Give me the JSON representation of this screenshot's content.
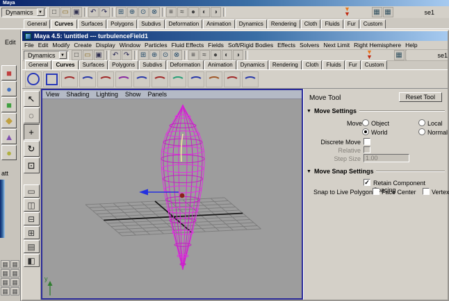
{
  "app": {
    "top_title": "Maya"
  },
  "mode_dropdown": "Dynamics",
  "status_right_text": "se1",
  "toolbar_icons": [
    {
      "n": "new-scene-icon",
      "g": "□",
      "c": "#333333"
    },
    {
      "n": "open-scene-icon",
      "g": "▭",
      "c": "#8a6a20"
    },
    {
      "n": "save-scene-icon",
      "g": "▣",
      "c": "#303050"
    },
    {
      "cls": "sep",
      "n": "separator"
    },
    {
      "n": "undo-icon",
      "g": "↶",
      "c": "#202050"
    },
    {
      "n": "redo-icon",
      "g": "↷",
      "c": "#202050"
    },
    {
      "cls": "sep",
      "n": "separator"
    },
    {
      "n": "snap-grid-icon",
      "g": "⊞",
      "c": "#204868"
    },
    {
      "n": "snap-curve-icon",
      "g": "⊕",
      "c": "#204868"
    },
    {
      "n": "snap-point-icon",
      "g": "⊙",
      "c": "#204868"
    },
    {
      "n": "snap-view-icon",
      "g": "⊗",
      "c": "#204868"
    },
    {
      "cls": "sep",
      "n": "separator"
    },
    {
      "n": "construction-history-icon",
      "g": "≡",
      "c": "#333333"
    },
    {
      "n": "list-inputs-icon",
      "g": "≈",
      "c": "#333333"
    },
    {
      "n": "render-icon",
      "g": "●",
      "c": "#444444"
    },
    {
      "n": "ipr-render-icon",
      "g": "◐",
      "c": "#444444"
    },
    {
      "n": "render-globals-icon",
      "g": "◑",
      "c": "#444444"
    },
    {
      "cls": "sep",
      "n": "separator"
    },
    {
      "n": "double-chevron-icon",
      "cls": "ic-varrow gap-left"
    },
    {
      "n": "numeric-field-grid-icon",
      "g": "▦",
      "c": "#305060",
      "cls": "gap-left-sm"
    },
    {
      "n": "numeric-field-grid-icon",
      "g": "▦",
      "c": "#305060"
    }
  ],
  "shelf_tabs": [
    {
      "label": "General"
    },
    {
      "label": "Curves",
      "selected": true
    },
    {
      "label": "Surfaces"
    },
    {
      "label": "Polygons"
    },
    {
      "label": "Subdivs"
    },
    {
      "label": "Deformation"
    },
    {
      "label": "Animation"
    },
    {
      "label": "Dynamics"
    },
    {
      "label": "Rendering"
    },
    {
      "label": "Cloth"
    },
    {
      "label": "Fluids"
    },
    {
      "label": "Fur"
    },
    {
      "label": "Custom"
    }
  ],
  "shelf_icons": [
    {
      "n": "nurbs-circle-icon",
      "cls": "ic-circle"
    },
    {
      "n": "nurbs-square-icon",
      "cls": "ic-square"
    },
    {
      "n": "pencil-curve-icon",
      "cls": "ic-arc",
      "c": "#a02828"
    },
    {
      "n": "cv-curve-icon",
      "cls": "ic-arc",
      "c": "#2838a8"
    },
    {
      "n": "ep-curve-icon",
      "cls": "ic-arc",
      "c": "#a02828"
    },
    {
      "n": "edit-curve-icon",
      "cls": "ic-arc",
      "c": "#8828a0"
    },
    {
      "n": "attach-curves-icon",
      "cls": "ic-arc",
      "c": "#2838a8"
    },
    {
      "n": "detach-curves-icon",
      "cls": "ic-arc",
      "c": "#a02828"
    },
    {
      "n": "align-curves-icon",
      "cls": "ic-arc",
      "c": "#28a078"
    },
    {
      "n": "open-close-curve-icon",
      "cls": "ic-arc",
      "c": "#2838a8"
    },
    {
      "n": "fillet-curve-icon",
      "cls": "ic-arc",
      "c": "#a05828"
    },
    {
      "n": "cut-curve-icon",
      "cls": "ic-arc",
      "c": "#a02828"
    },
    {
      "n": "intersect-curves-icon",
      "cls": "ic-arc",
      "c": "#2838a8"
    }
  ],
  "toolbox_icons": [
    {
      "n": "select-tool-icon",
      "g": "↖"
    },
    {
      "n": "lasso-select-tool-icon",
      "g": "◌"
    },
    {
      "n": "move-tool-icon",
      "g": "+",
      "cls": "pressed"
    },
    {
      "n": "rotate-tool-icon",
      "g": "↻"
    },
    {
      "n": "scale-tool-icon",
      "g": "⊡"
    }
  ],
  "layout_icons": [
    {
      "n": "single-pane-layout-icon",
      "g": "▭"
    },
    {
      "n": "two-pane-side-layout-icon",
      "g": "◫"
    },
    {
      "n": "two-pane-stacked-layout-icon",
      "g": "⊟"
    },
    {
      "n": "four-pane-layout-icon",
      "g": "⊞"
    },
    {
      "n": "outliner-persp-layout-icon",
      "g": "▤"
    },
    {
      "n": "split-pane-layout-icon",
      "g": "◧"
    }
  ],
  "left_strip": {
    "edit_label": "Edit",
    "att_label": "att",
    "tool_icons": [
      {
        "n": "cube-primitive-icon",
        "g": "■",
        "c": "#c04040"
      },
      {
        "n": "sphere-primitive-icon",
        "g": "●",
        "c": "#4070c0"
      },
      {
        "n": "cube-primitive-icon",
        "g": "■",
        "c": "#40a040"
      },
      {
        "n": "cone-primitive-icon",
        "g": "◆",
        "c": "#c0a040"
      },
      {
        "n": "light-icon",
        "g": "▲",
        "c": "#8050b0"
      },
      {
        "n": "sphere-primitive-icon",
        "g": "●",
        "c": "#b0b040"
      }
    ],
    "grid_icons": [
      {
        "n": "panel-icon",
        "g": "▦",
        "c": "#555555"
      },
      {
        "n": "panel-icon",
        "g": "▦",
        "c": "#555555"
      },
      {
        "n": "panel-icon",
        "g": "▦",
        "c": "#555555"
      },
      {
        "n": "panel-icon",
        "g": "▦",
        "c": "#555555"
      },
      {
        "n": "panel-icon",
        "g": "▦",
        "c": "#555555"
      },
      {
        "n": "panel-icon",
        "g": "▦",
        "c": "#555555"
      },
      {
        "n": "panel-icon",
        "g": "▦",
        "c": "#555555"
      },
      {
        "n": "panel-icon",
        "g": "▦",
        "c": "#555555"
      }
    ]
  },
  "window": {
    "title": "Maya 4.5: \\untitled   ---   turbulenceField1",
    "menus": [
      "File",
      "Edit",
      "Modify",
      "Create",
      "Display",
      "Window",
      "Particles",
      "Fluid Effects",
      "Fields",
      "Soft/Rigid Bodies",
      "Effects",
      "Solvers",
      "Next Limit",
      "Right Hemisphere",
      "Help"
    ]
  },
  "viewport": {
    "menus": [
      "View",
      "Shading",
      "Lighting",
      "Show",
      "Panels"
    ],
    "axis_label": "y"
  },
  "tool_settings": {
    "title": "Move Tool",
    "reset_button": "Reset Tool",
    "move_settings": {
      "header": "Move Settings",
      "move_label": "Move",
      "object": "Object",
      "world": "World",
      "local": "Local",
      "normal": "Normal",
      "selected": "World",
      "discrete_move": "Discrete Move",
      "relative": "Relative",
      "step_size": "Step Size",
      "step_size_value": "1.00"
    },
    "snap_settings": {
      "header": "Move Snap Settings",
      "retain": "Retain Component Spacing",
      "retain_checked": true,
      "snap_live": "Snap to Live Polygon",
      "face_center": "Face Center",
      "vertex": "Vertex"
    }
  },
  "colors": {
    "titlebar_blue": "#0a246a",
    "viewport_gray": "#9d9d9d",
    "wireframe_magenta": "#e032e0",
    "manipulator_blue": "#2430e0",
    "panel_border_blue": "#2b2b9a"
  }
}
